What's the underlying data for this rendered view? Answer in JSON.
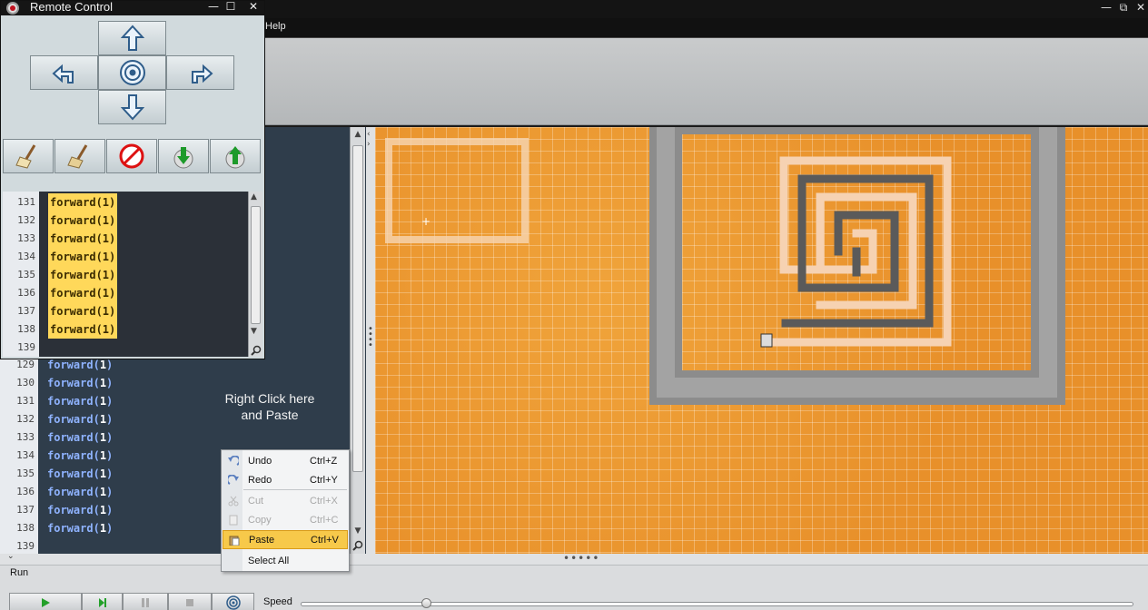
{
  "menubar": {
    "help": "Help"
  },
  "main_window": {
    "min": "—",
    "max": "⧉",
    "close": "✕"
  },
  "remote": {
    "title": "Remote Control",
    "min": "—",
    "max": "☐",
    "close": "✕",
    "lines": [
      {
        "n": "131",
        "code": "forward(1)"
      },
      {
        "n": "132",
        "code": "forward(1)"
      },
      {
        "n": "133",
        "code": "forward(1)"
      },
      {
        "n": "134",
        "code": "forward(1)"
      },
      {
        "n": "135",
        "code": "forward(1)"
      },
      {
        "n": "136",
        "code": "forward(1)"
      },
      {
        "n": "137",
        "code": "forward(1)"
      },
      {
        "n": "138",
        "code": "forward(1)"
      }
    ],
    "last_line": "139"
  },
  "editor": {
    "lines": [
      {
        "n": "129",
        "fn": "forward",
        "arg": "1"
      },
      {
        "n": "130",
        "fn": "forward",
        "arg": "1"
      },
      {
        "n": "131",
        "fn": "forward",
        "arg": "1"
      },
      {
        "n": "132",
        "fn": "forward",
        "arg": "1"
      },
      {
        "n": "133",
        "fn": "forward",
        "arg": "1"
      },
      {
        "n": "134",
        "fn": "forward",
        "arg": "1"
      },
      {
        "n": "135",
        "fn": "forward",
        "arg": "1"
      },
      {
        "n": "136",
        "fn": "forward",
        "arg": "1"
      },
      {
        "n": "137",
        "fn": "forward",
        "arg": "1"
      },
      {
        "n": "138",
        "fn": "forward",
        "arg": "1"
      }
    ],
    "last_line": "139",
    "hint_line1": "Right Click here",
    "hint_line2": "and Paste"
  },
  "context_menu": {
    "items": [
      {
        "label": "Undo",
        "shortcut": "Ctrl+Z",
        "enabled": true
      },
      {
        "label": "Redo",
        "shortcut": "Ctrl+Y",
        "enabled": true
      },
      {
        "label": "Cut",
        "shortcut": "Ctrl+X",
        "enabled": false
      },
      {
        "label": "Copy",
        "shortcut": "Ctrl+C",
        "enabled": false
      },
      {
        "label": "Paste",
        "shortcut": "Ctrl+V",
        "enabled": true,
        "highlighted": true
      },
      {
        "label": "Select All",
        "shortcut": "",
        "enabled": true
      }
    ]
  },
  "runbar": {
    "run_label": "Run",
    "speed_label": "Speed",
    "speed_value": 0.15
  },
  "colors": {
    "accent": "#f7c94a",
    "world": "#e8902a",
    "wall": "#8c8c8c",
    "trail_light": "#f6d2b2",
    "trail_dark": "#5a5a5a"
  },
  "icons": [
    "up-arrow-icon",
    "left-turn-icon",
    "target-icon",
    "right-turn-icon",
    "down-arrow-icon",
    "broom-icon",
    "no-paint-icon",
    "download-icon",
    "upload-icon",
    "play-icon",
    "step-icon",
    "pause-icon",
    "stop-icon"
  ]
}
